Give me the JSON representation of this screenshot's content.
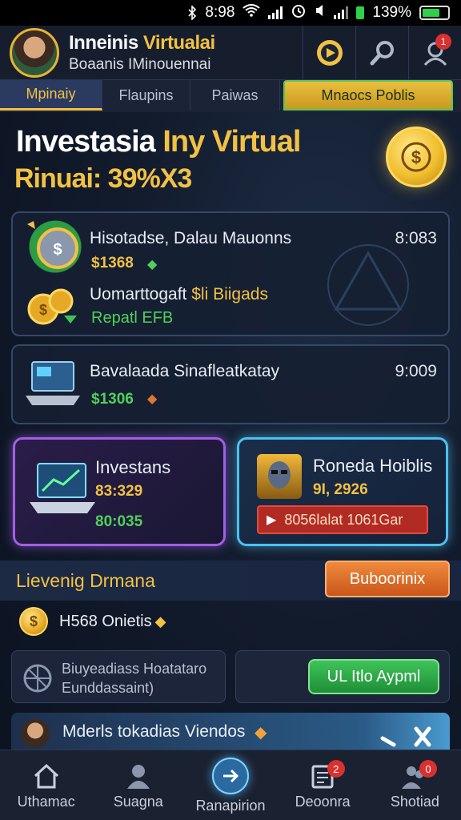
{
  "status_bar": {
    "time": "8:98",
    "battery": "139%"
  },
  "header": {
    "title_white": "Inneinis",
    "title_gold": "Virtualai",
    "subtitle": "Boaanis IMinouennai",
    "notification_count": "1"
  },
  "tabs": [
    {
      "label": "Mpinaiy"
    },
    {
      "label": "Flaupins"
    },
    {
      "label": "Paiwas"
    },
    {
      "label": "Mnaocs Poblis"
    }
  ],
  "hero": {
    "title_white": "Investasia",
    "title_gold": "Iny Virtual",
    "subtitle": "Rinuai: 39%X3"
  },
  "card_a": {
    "row1": {
      "label": "Hisotadse, Dalau Mauonns",
      "amount": "$1368",
      "time": "8:083"
    },
    "row2": {
      "label_white": "Uomarttogaft",
      "label_gold": "$li Biigads",
      "status": "Repatl EFB"
    }
  },
  "card_b": {
    "label": "Bavalaada Sinafleatkatay",
    "amount": "$1306",
    "time": "9:009"
  },
  "promo_left": {
    "title": "Investans",
    "value": "83:329",
    "sub": "80:035"
  },
  "promo_right": {
    "title": "Roneda Hoiblis",
    "value": "9I, 2926",
    "button": "8056lalat 1061Gar"
  },
  "leaderboard": {
    "title": "Lievenig Drmana",
    "button": "Buboorinix"
  },
  "coins_row": {
    "label": "H568 Onietis"
  },
  "panel_left": {
    "line1": "Biuyeadiass Hoatataro",
    "line2": "Eunddassaint)"
  },
  "panel_right": {
    "button": "UL Itlo Aypml"
  },
  "news": {
    "label": "Mderls tokadias Viendos"
  },
  "bottom_nav": [
    {
      "label": "Uthamac"
    },
    {
      "label": "Suagna"
    },
    {
      "label": "Ranapirion"
    },
    {
      "label": "Deoonra",
      "badge": "2"
    },
    {
      "label": "Shotiad",
      "badge": "0"
    }
  ],
  "colors": {
    "gold": "#f2c144",
    "green": "#4fd15a",
    "purple": "#a35ee8",
    "cyan": "#4cc1f2",
    "orange": "#e0762e"
  }
}
